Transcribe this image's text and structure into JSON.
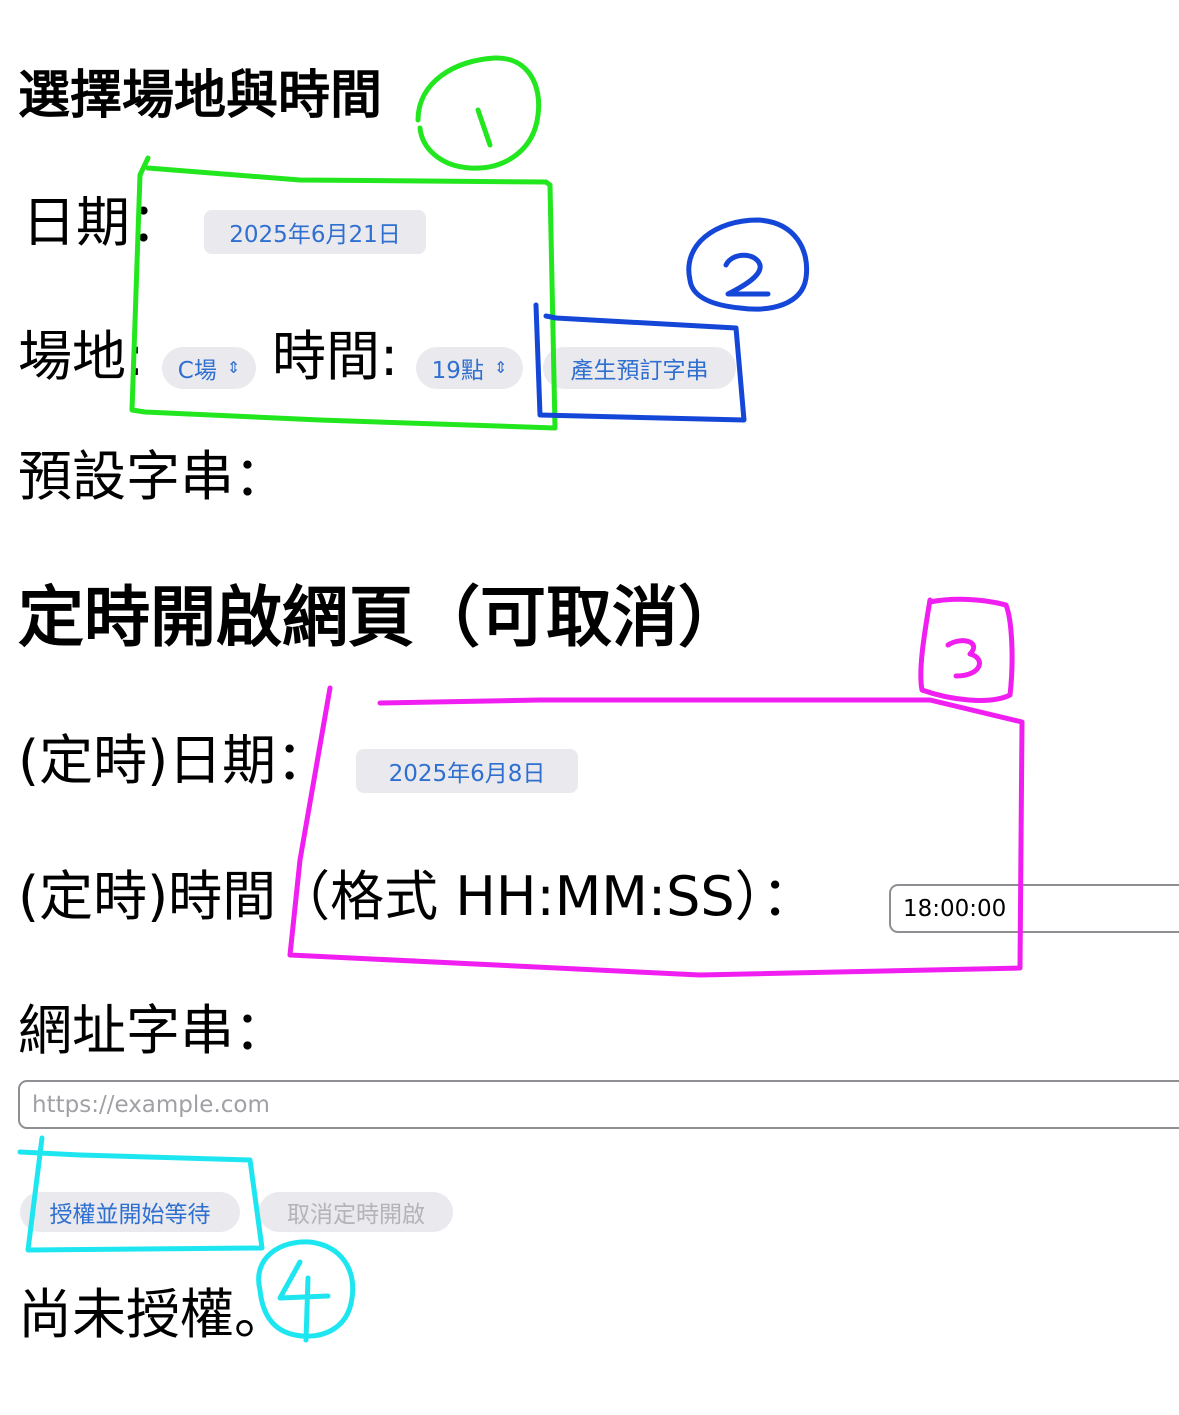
{
  "section1": {
    "title": "選擇場地與時間",
    "date_label": "日期：",
    "date_value": "2025年6月21日",
    "venue_label": "場地:",
    "venue_value": "C場",
    "time_label": "時間:",
    "time_value": "19點",
    "generate_button": "產生預訂字串",
    "preset_label": "預設字串："
  },
  "section2": {
    "title": "定時開啟網頁（可取消）",
    "timer_date_label": "(定時)日期：",
    "timer_date_value": "2025年6月8日",
    "timer_time_label": "(定時)時間（格式 HH:MM:SS）：",
    "timer_time_value": "18:00:00",
    "url_label": "網址字串：",
    "url_placeholder": "https://example.com",
    "authorize_button": "授權並開始等待",
    "cancel_button": "取消定時開啟",
    "status": "尚未授權。"
  },
  "annotations": {
    "marks": [
      "1",
      "2",
      "3",
      "4"
    ],
    "colors": {
      "box1": "#22e61e",
      "box2": "#1446d8",
      "box3": "#f01ef0",
      "box4": "#1ee6f0"
    }
  },
  "colors": {
    "accent": "#2f6fd0",
    "pill_bg": "#e9e9ee",
    "disabled_text": "#b4b4b8"
  }
}
